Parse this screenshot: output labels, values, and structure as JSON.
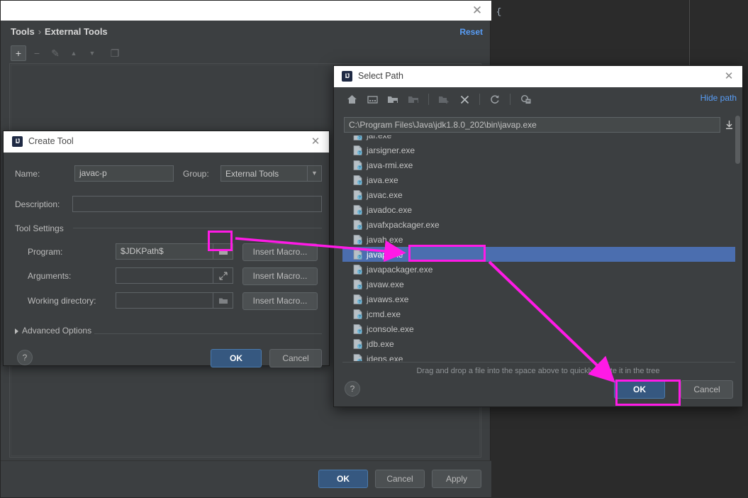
{
  "background": {
    "editor_text": "{"
  },
  "settings_window": {
    "breadcrumb": {
      "root": "Tools",
      "separator": "›",
      "current": "External Tools"
    },
    "reset_label": "Reset",
    "toolbar": [
      {
        "name": "add",
        "glyph": "+",
        "enabled": true
      },
      {
        "name": "remove",
        "glyph": "−",
        "enabled": false
      },
      {
        "name": "edit",
        "glyph": "✎",
        "enabled": false
      },
      {
        "name": "move-up",
        "glyph": "▲",
        "enabled": false
      },
      {
        "name": "move-down",
        "glyph": "▼",
        "enabled": false
      },
      {
        "name": "copy",
        "glyph": "❐",
        "enabled": false
      }
    ],
    "footer": {
      "ok": "OK",
      "cancel": "Cancel",
      "apply": "Apply"
    }
  },
  "create_tool": {
    "title": "Create Tool",
    "close_glyph": "✕",
    "ij_icon_text": "IJ",
    "name_label": "Name:",
    "name_value": "javac-p",
    "group_label": "Group:",
    "group_value": "External Tools",
    "description_label": "Description:",
    "description_value": "",
    "tool_settings_label": "Tool Settings",
    "program_label": "Program:",
    "program_value": "$JDKPath$",
    "arguments_label": "Arguments:",
    "arguments_value": "",
    "working_directory_label": "Working directory:",
    "working_directory_value": "",
    "insert_macro_label": "Insert Macro...",
    "advanced_options_label": "Advanced Options",
    "help_glyph": "?",
    "ok": "OK",
    "cancel": "Cancel"
  },
  "select_path": {
    "title": "Select Path",
    "close_glyph": "✕",
    "ij_icon_text": "IJ",
    "toolbar": [
      {
        "name": "home-icon",
        "enabled": true
      },
      {
        "name": "desktop-icon",
        "enabled": true
      },
      {
        "name": "project-folder-icon",
        "enabled": true
      },
      {
        "name": "module-folder-icon",
        "enabled": false
      },
      {
        "name": "new-folder-icon",
        "enabled": false
      },
      {
        "name": "delete-icon",
        "enabled": true
      },
      {
        "name": "refresh-icon",
        "enabled": true
      },
      {
        "name": "show-hidden-icon",
        "enabled": true
      }
    ],
    "hide_path_label": "Hide path",
    "path_value": "C:\\Program Files\\Java\\jdk1.8.0_202\\bin\\javap.exe",
    "files": [
      {
        "name": "jar.exe",
        "selected": false,
        "clipped": true
      },
      {
        "name": "jarsigner.exe",
        "selected": false
      },
      {
        "name": "java-rmi.exe",
        "selected": false
      },
      {
        "name": "java.exe",
        "selected": false
      },
      {
        "name": "javac.exe",
        "selected": false
      },
      {
        "name": "javadoc.exe",
        "selected": false
      },
      {
        "name": "javafxpackager.exe",
        "selected": false
      },
      {
        "name": "javah.exe",
        "selected": false
      },
      {
        "name": "javap.exe",
        "selected": true
      },
      {
        "name": "javapackager.exe",
        "selected": false
      },
      {
        "name": "javaw.exe",
        "selected": false
      },
      {
        "name": "javaws.exe",
        "selected": false
      },
      {
        "name": "jcmd.exe",
        "selected": false
      },
      {
        "name": "jconsole.exe",
        "selected": false
      },
      {
        "name": "jdb.exe",
        "selected": false
      },
      {
        "name": "jdeps.exe",
        "selected": false
      }
    ],
    "hint": "Drag and drop a file into the space above to quickly locate it in the tree",
    "help_glyph": "?",
    "ok": "OK",
    "cancel": "Cancel"
  },
  "annotations": {
    "accent_color": "#ff1ae6",
    "highlights": [
      "program-browse-button",
      "javap-exe-row",
      "select-path-ok-button"
    ],
    "arrows": [
      {
        "from": "program-browse-button",
        "to": "javap-exe-row"
      },
      {
        "from": "javap-exe-row",
        "to": "select-path-ok-button"
      }
    ]
  },
  "colors": {
    "window_bg": "#3c3f41",
    "editor_bg": "#2b2b2b",
    "selection_blue": "#4b6eaf",
    "primary_button": "#365880",
    "link_blue": "#589df6",
    "accent_magenta": "#ff1ae6"
  }
}
